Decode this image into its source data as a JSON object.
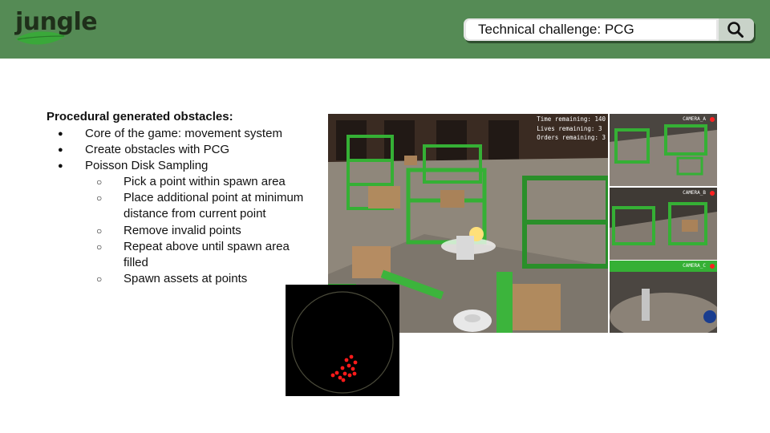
{
  "header": {
    "logo_text": "jungle",
    "search_text": "Technical challenge: PCG"
  },
  "icons": {
    "logo": "leaf-icon",
    "search": "search-icon"
  },
  "colors": {
    "header_bg": "#558b55",
    "accent_green": "#3cb43c",
    "point_red": "#ff1a1a"
  },
  "content": {
    "title": "Procedural generated obstacles:",
    "bullets": [
      {
        "text": "Core of the game: movement system"
      },
      {
        "text": "Create obstacles with PCG"
      },
      {
        "text": "Poisson Disk Sampling",
        "sub": [
          "Pick a point within spawn area",
          "Place additional point at minimum distance from current point",
          "Remove invalid points",
          "Repeat above until spawn area filled",
          "Spawn assets at points"
        ]
      }
    ]
  },
  "game_screenshot": {
    "hud": {
      "time_remaining": "Time remaining: 140",
      "lives_remaining": "Lives remaining: 3",
      "orders_remaining": "Orders remaining: 3"
    },
    "cameras": [
      "CAMERA_A",
      "CAMERA_B",
      "CAMERA_C"
    ]
  }
}
